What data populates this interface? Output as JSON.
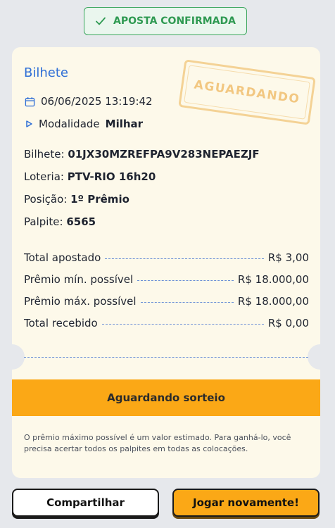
{
  "header": {
    "status_label": "APOSTA CONFIRMADA",
    "icon": "check-icon",
    "accent_color": "#3aa55d"
  },
  "ticket": {
    "title": "Bilhete",
    "datetime": "06/06/2025 13:19:42",
    "modalidade_label": "Modalidade",
    "modalidade_value": "Milhar",
    "stamp": "AGUARDANDO",
    "fields": [
      {
        "label": "Bilhete:",
        "value": "01JX30MZREFPA9V283NEPAEZJF"
      },
      {
        "label": "Loteria:",
        "value": "PTV-RIO 16h20"
      },
      {
        "label": "Posição:",
        "value": "1º Prêmio"
      },
      {
        "label": "Palpite:",
        "value": "6565"
      }
    ],
    "totals": [
      {
        "label": "Total apostado",
        "value": "R$ 3,00"
      },
      {
        "label": "Prêmio mín. possível",
        "value": "R$ 18.000,00"
      },
      {
        "label": "Prêmio máx. possível",
        "value": "R$ 18.000,00"
      },
      {
        "label": "Total recebido",
        "value": "R$ 0,00"
      }
    ],
    "status_banner": "Aguardando sorteio",
    "disclaimer": "O prêmio máximo possível é um valor estimado. Para ganhá-lo, você precisa acertar todos os palpites em todas as colocações."
  },
  "actions": {
    "share_label": "Compartilhar",
    "play_again_label": "Jogar novamente!"
  },
  "colors": {
    "primary_orange": "#fba816",
    "link_blue": "#2f6fd6",
    "ticket_bg": "#fdf9ea"
  }
}
